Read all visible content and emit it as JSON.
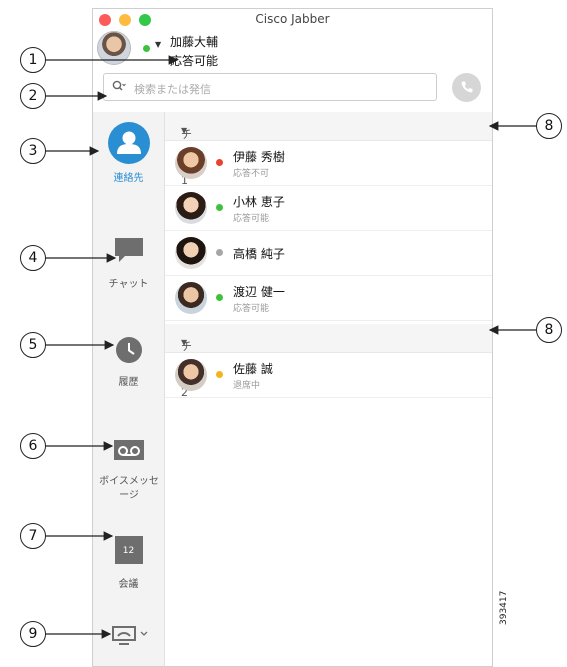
{
  "app": {
    "title": "Cisco Jabber"
  },
  "user": {
    "name": "加藤大輔",
    "status": "応答可能"
  },
  "search": {
    "placeholder": "検索または発信"
  },
  "nav": {
    "contacts": "連絡先",
    "chat": "チャット",
    "history": "履歴",
    "voicemail": "ボイスメッセージ",
    "meetings": "会議",
    "calendar_day": "12"
  },
  "groups": [
    {
      "name": "チーム1",
      "contacts": [
        {
          "name": "伊藤 秀樹",
          "status": "応答不可",
          "dot": "#e8432e"
        },
        {
          "name": "小林 恵子",
          "status": "応答可能",
          "dot": "#3fc23b"
        },
        {
          "name": "高橋 純子",
          "status": "",
          "dot": "#a6a6a6"
        },
        {
          "name": "渡辺 健一",
          "status": "応答可能",
          "dot": "#3fc23b"
        }
      ]
    },
    {
      "name": "チーム2",
      "contacts": [
        {
          "name": "佐藤 誠",
          "status": "退席中",
          "dot": "#f2b51b"
        }
      ]
    }
  ],
  "callouts": [
    "1",
    "2",
    "3",
    "4",
    "5",
    "6",
    "7",
    "8",
    "8",
    "9"
  ],
  "figure_id": "393417",
  "colors": {
    "accent": "#2a8ed3",
    "available": "#3fc23b",
    "busy": "#e8432e",
    "away": "#f2b51b",
    "offline": "#a6a6a6"
  }
}
